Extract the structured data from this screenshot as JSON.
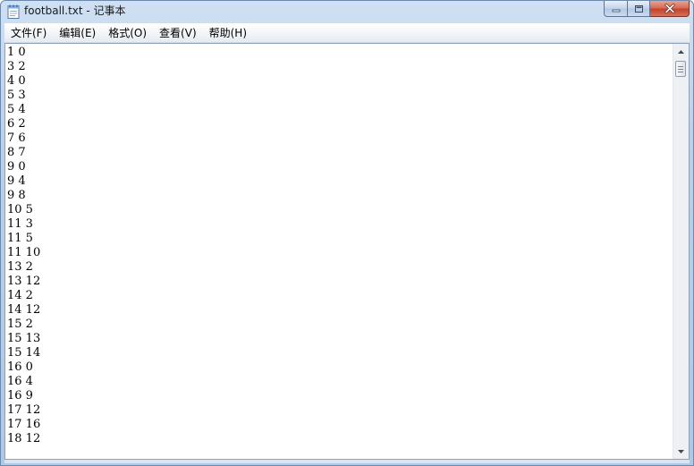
{
  "window": {
    "title": "football.txt - 记事本",
    "icon": "notepad-icon"
  },
  "menu": {
    "items": [
      {
        "label": "文件(F)"
      },
      {
        "label": "编辑(E)"
      },
      {
        "label": "格式(O)"
      },
      {
        "label": "查看(V)"
      },
      {
        "label": "帮助(H)"
      }
    ]
  },
  "document": {
    "lines": [
      "1 0",
      "3 2",
      "4 0",
      "5 3",
      "5 4",
      "6 2",
      "7 6",
      "8 7",
      "9 0",
      "9 4",
      "9 8",
      "10 5",
      "11 3",
      "11 5",
      "11 10",
      "13 2",
      "13 12",
      "14 2",
      "14 12",
      "15 2",
      "15 13",
      "15 14",
      "16 0",
      "16 4",
      "16 9",
      "17 12",
      "17 16",
      "18 12"
    ]
  },
  "colors": {
    "frame": "#b9d1ea",
    "close_button": "#c4422a",
    "text": "#000000"
  }
}
